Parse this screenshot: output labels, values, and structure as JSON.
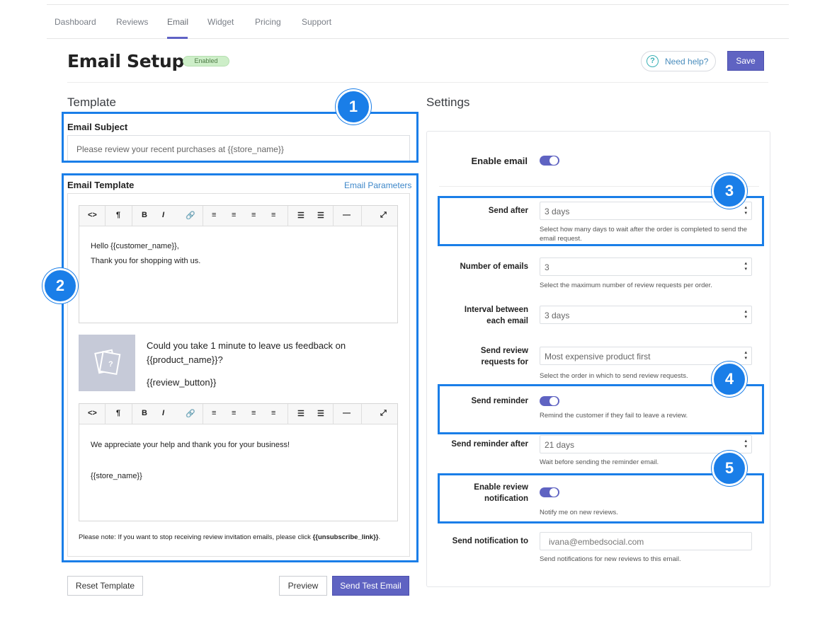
{
  "nav": {
    "items": [
      "Dashboard",
      "Reviews",
      "Email",
      "Widget",
      "Pricing",
      "Support"
    ],
    "active": "Email"
  },
  "header": {
    "title": "Email Setup",
    "status": "Enabled",
    "help_label": "Need help?",
    "help_icon": "?",
    "save_label": "Save"
  },
  "template": {
    "section_title": "Template",
    "subject_label": "Email Subject",
    "subject_value": "Please review your recent purchases at {{store_name}}",
    "template_label": "Email Template",
    "params_link": "Email Parameters",
    "toolbar": [
      "<>",
      "¶",
      "B",
      "I",
      "🔗",
      "≡",
      "≡",
      "≡",
      "≡",
      "☰",
      "☰",
      "—",
      "⤢"
    ],
    "editor1_line1": "Hello {{customer_name}},",
    "editor1_line2": "Thank you for shopping with us.",
    "product_line1": "Could you take 1 minute to leave us feedback on",
    "product_line2": "{{product_name}}?",
    "product_button": "{{review_button}}",
    "product_img_mark": "?",
    "editor2_line1": "We appreciate your help and thank you for your business!",
    "editor2_line2": "{{store_name}}",
    "note_text": "Please note: If you want to stop receiving review invitation emails, please click ",
    "note_link": "{{unsubscribe_link}}",
    "note_end": ".",
    "reset_label": "Reset Template",
    "preview_label": "Preview",
    "test_label": "Send Test Email"
  },
  "settings": {
    "section_title": "Settings",
    "enable_email_label": "Enable email",
    "send_after_label": "Send after",
    "send_after_value": "3 days",
    "send_after_help": "Select how many days to wait after the order is completed to send the email request.",
    "num_emails_label": "Number of emails",
    "num_emails_value": "3",
    "num_emails_help": "Select the maximum number of review requests per order.",
    "interval_label_1": "Interval between",
    "interval_label_2": "each email",
    "interval_value": "3 days",
    "send_for_label_1": "Send review",
    "send_for_label_2": "requests for",
    "send_for_value": "Most expensive product first",
    "send_for_help": "Select the order in which to send review requests.",
    "reminder_label": "Send reminder",
    "reminder_help": "Remind the customer if they fail to leave a review.",
    "reminder_after_label": "Send reminder after",
    "reminder_after_value": "21 days",
    "reminder_after_help": "Wait before sending the reminder email.",
    "notif_label_1": "Enable review",
    "notif_label_2": "notification",
    "notif_help": "Notify me on new reviews.",
    "notify_to_label": "Send notification to",
    "notify_to_value": "ivana@embedsocial.com",
    "notify_to_help": "Send notifications for new reviews to this email."
  },
  "annotations": [
    "1",
    "2",
    "3",
    "4",
    "5"
  ],
  "colors": {
    "accent": "#5f63c2",
    "annotation": "#1a7ee8",
    "badge_green": "#cdeec8"
  }
}
